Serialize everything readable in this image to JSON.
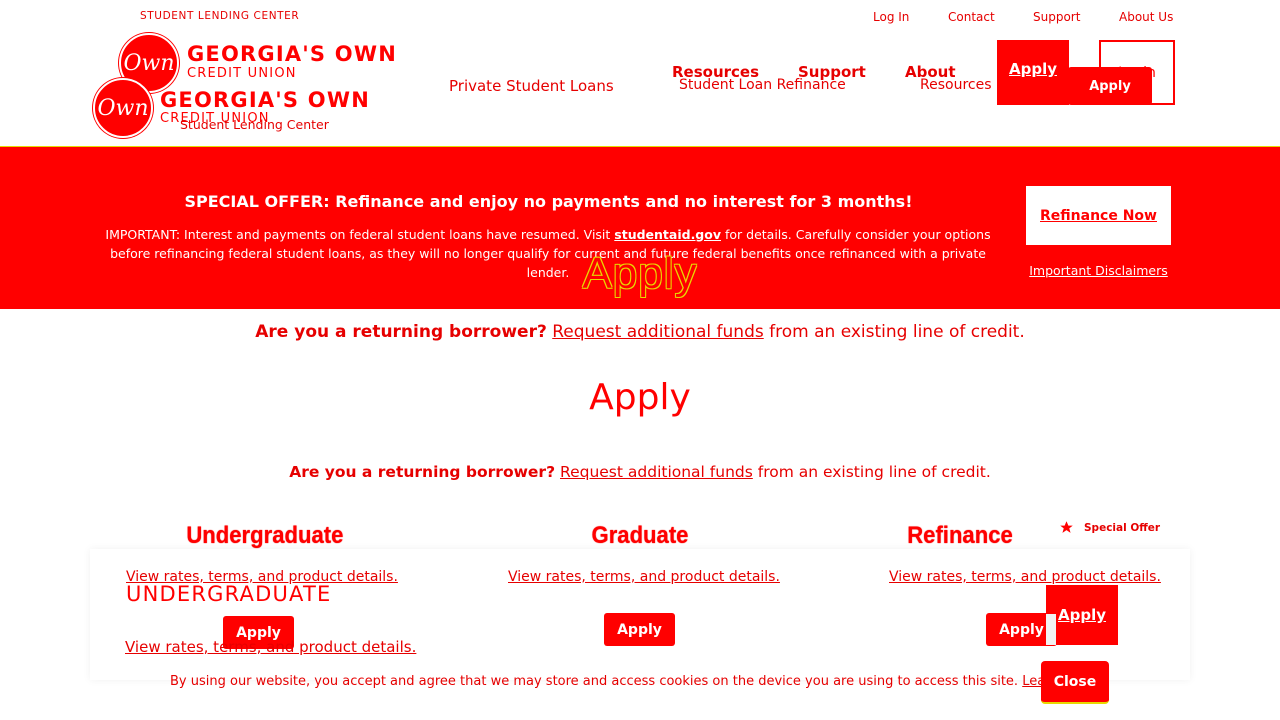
{
  "header": {
    "tagline": "STUDENT LENDING CENTER",
    "top_links": [
      "Log In",
      "Contact",
      "Support",
      "About Us"
    ],
    "logo": {
      "mark": "Own",
      "name": "GEORGIA'S OWN",
      "sub": "CREDIT UNION"
    },
    "logo_overlay_sub": "Student Lending Center",
    "nav": {
      "private_loans": "Private Student Loans",
      "resources": "Resources",
      "support": "Support",
      "about": "About",
      "refinance": "Student Loan Refinance",
      "resources_small": "Resources",
      "apply": "Apply",
      "apply_small": "Apply",
      "login": "Login"
    }
  },
  "banner": {
    "headline": "SPECIAL OFFER: Refinance and enjoy no payments and no interest for 3 months!",
    "notice_pre": "IMPORTANT: Interest and payments on federal student loans have resumed. Visit ",
    "notice_link": "studentaid.gov",
    "notice_post": " for details. Carefully consider your options before refinancing federal student loans, as they will no longer qualify for current and future federal benefits once refinanced with a private lender.",
    "refinance_button": "Refinance Now",
    "disclaimers": "Important Disclaimers",
    "ghost_title": "Apply"
  },
  "returning": {
    "question": "Are you a returning borrower?",
    "link": "Request additional funds",
    "rest": " from an existing line of credit."
  },
  "page_title": "Apply",
  "columns": {
    "undergrad": "Undergraduate",
    "graduate": "Graduate",
    "refinance": "Refinance",
    "special_offer": "Special Offer",
    "undergrad_caps": "UNDERGRADUATE"
  },
  "view_link": "View rates, terms, and product details.",
  "apply_label": "Apply",
  "cookie": {
    "text": "By using our website, you accept and agree that we may store and access cookies on the device you are using to access this site.",
    "learn_more": "Learn More",
    "close": "Close"
  }
}
